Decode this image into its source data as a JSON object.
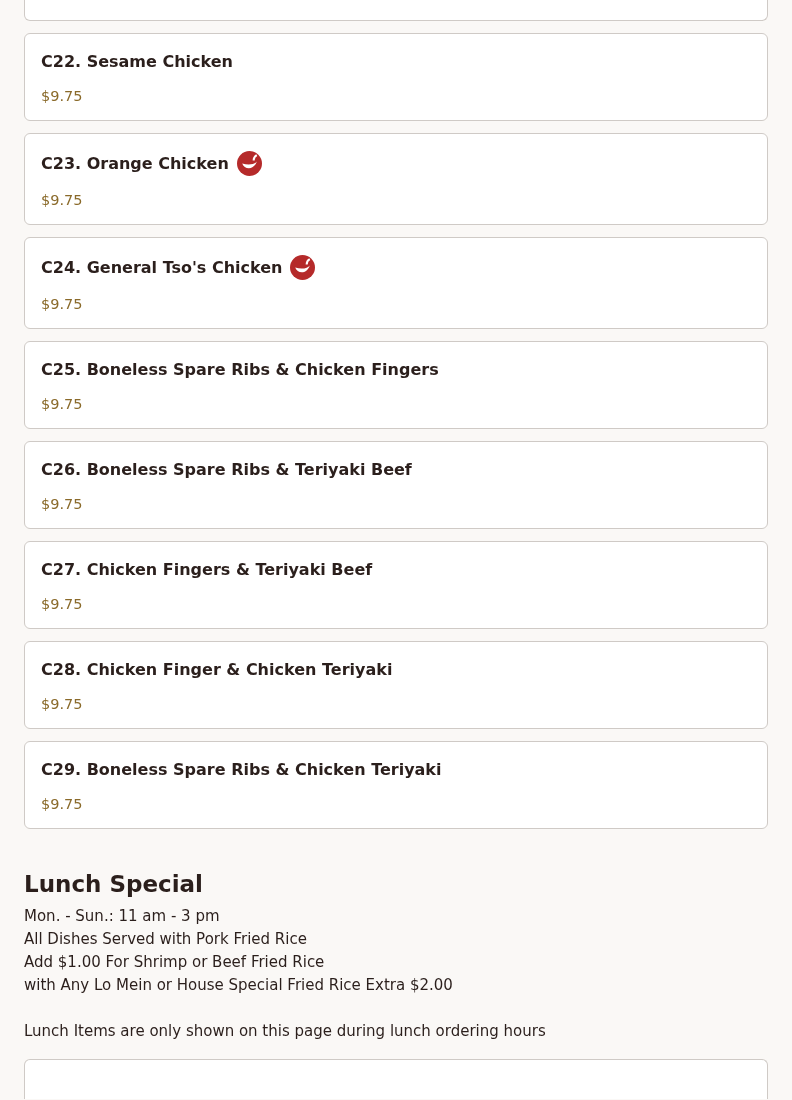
{
  "items": [
    {
      "name": "C22. Sesame Chicken",
      "price": "$9.75",
      "spicy": false
    },
    {
      "name": "C23. Orange Chicken",
      "price": "$9.75",
      "spicy": true
    },
    {
      "name": "C24. General Tso's Chicken",
      "price": "$9.75",
      "spicy": true
    },
    {
      "name": "C25. Boneless Spare Ribs & Chicken Fingers",
      "price": "$9.75",
      "spicy": false
    },
    {
      "name": "C26. Boneless Spare Ribs & Teriyaki Beef",
      "price": "$9.75",
      "spicy": false
    },
    {
      "name": "C27. Chicken Fingers & Teriyaki Beef",
      "price": "$9.75",
      "spicy": false
    },
    {
      "name": "C28. Chicken Finger & Chicken Teriyaki",
      "price": "$9.75",
      "spicy": false
    },
    {
      "name": "C29. Boneless Spare Ribs & Chicken Teriyaki",
      "price": "$9.75",
      "spicy": false
    }
  ],
  "section": {
    "title": "Lunch Special",
    "lines": [
      "Mon. - Sun.: 11 am - 3 pm",
      "All Dishes Served with Pork Fried Rice",
      "Add $1.00 For Shrimp or Beef Fried Rice",
      "with Any Lo Mein or House Special Fried Rice Extra $2.00"
    ],
    "note": "Lunch Items are only shown on this page during lunch ordering hours"
  }
}
